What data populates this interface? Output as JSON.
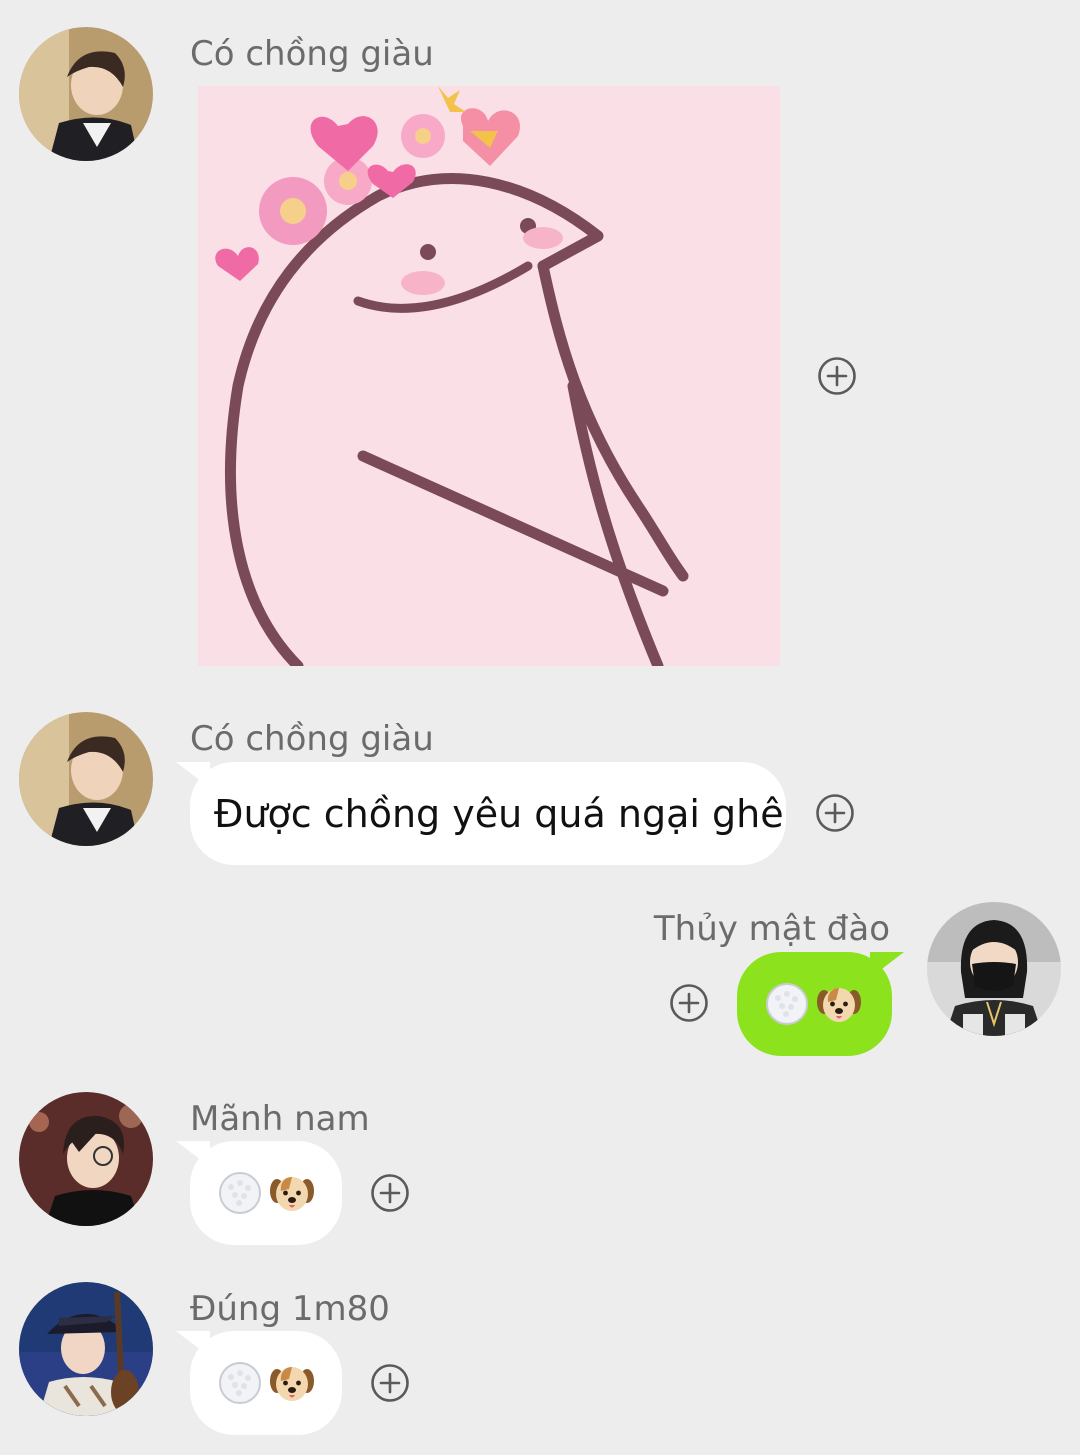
{
  "messages": [
    {
      "sender": "Có chồng giàu",
      "type": "sticker",
      "sticker_name": "shy-bird-flower-crown"
    },
    {
      "sender": "Có chồng giàu",
      "type": "text",
      "text": "Được chồng yêu quá ngại ghê"
    },
    {
      "sender": "Thủy mật đào",
      "type": "emoji",
      "mine": true,
      "emoji": [
        "rice-bowl-emoji",
        "dog-face-emoji"
      ]
    },
    {
      "sender": "Mãnh nam",
      "type": "emoji",
      "emoji": [
        "rice-bowl-emoji",
        "dog-face-emoji"
      ]
    },
    {
      "sender": "Đúng 1m80",
      "type": "emoji",
      "emoji": [
        "rice-bowl-emoji",
        "dog-face-emoji"
      ]
    }
  ],
  "colors": {
    "background": "#ededed",
    "incoming_bubble": "#ffffff",
    "outgoing_bubble": "#8ce21c",
    "sender_name": "#6b6b6b",
    "sticker_bg": "#fbdfe6",
    "sticker_line": "#7a4a59"
  },
  "icons": {
    "react": "plus-circle-icon"
  }
}
